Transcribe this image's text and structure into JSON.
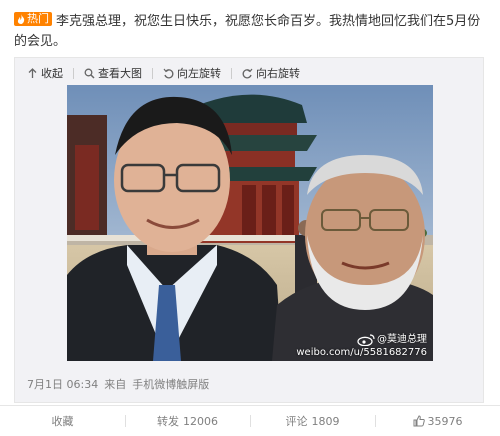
{
  "post": {
    "hot_badge": "热门",
    "text_prefix": "李克强总理，祝您生日快乐，祝愿您长命百岁。我热情地回忆我们在5月份的会见。"
  },
  "media_toolbar": {
    "collapse": "收起",
    "view_large": "查看大图",
    "rotate_left": "向左旋转",
    "rotate_right": "向右旋转"
  },
  "photo": {
    "watermark_user": "@莫迪总理",
    "watermark_url": "weibo.com/u/5581682776"
  },
  "meta": {
    "time": "7月1日 06:34",
    "source_prefix": "来自",
    "source": "手机微博触屏版"
  },
  "actions": {
    "favorite": "收藏",
    "repost_label": "转发",
    "repost_count": "12006",
    "comment_label": "评论",
    "comment_count": "1809",
    "like_count": "35976"
  },
  "colors": {
    "accent": "#ff8200",
    "link": "#eb7350",
    "meta_gray": "#808080"
  }
}
